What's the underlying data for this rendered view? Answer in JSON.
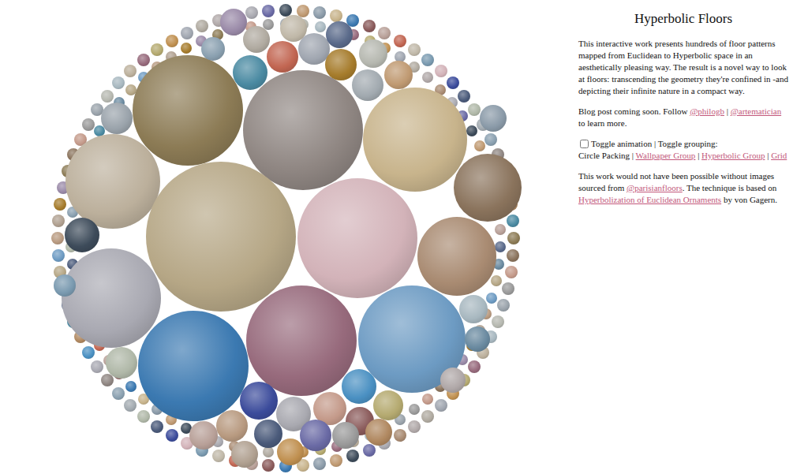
{
  "title": "Hyperbolic Floors",
  "intro": "This interactive work presents hundreds of floor patterns mapped from Euclidean to Hyperbolic space in an aesthetically pleasing way. The result is a novel way to look at floors: transcending the geometry they're confined in -and depicting their infinite nature in a compact way.",
  "follow": {
    "before": "Blog post coming soon. Follow ",
    "links": [
      "@philogb",
      "@artematician"
    ],
    "separator": " | ",
    "after": " to learn more."
  },
  "controls": {
    "animation": {
      "label": "Toggle animation",
      "checked": false
    },
    "grouping_label": " | Toggle grouping:",
    "separator": " | ",
    "grouping": [
      {
        "label": "Circle Packing",
        "selected": true
      },
      {
        "label": "Wallpaper Group",
        "selected": false
      },
      {
        "label": "Hyperbolic Group",
        "selected": false
      },
      {
        "label": "Grid",
        "selected": false
      }
    ]
  },
  "credits": {
    "before": "This work would not have been possible without images sourced from ",
    "source": "@parisianfloors",
    "middle": ". The technique is based on ",
    "paper": "Hyperbolization of Euclidean Ornaments",
    "after": " by von Gagern."
  },
  "circles": [
    {
      "color": "#8c7b55"
    },
    {
      "color": "#8f8682"
    },
    {
      "color": "#c8b48c"
    },
    {
      "color": "#bcb09c"
    },
    {
      "color": "#b6a786"
    },
    {
      "color": "#d3b3b9"
    },
    {
      "color": "#a98b72"
    },
    {
      "color": "#8a735c"
    },
    {
      "color": "#a9a9b2"
    },
    {
      "color": "#3b79b1"
    },
    {
      "color": "#976a7c"
    },
    {
      "color": "#6d9bc3"
    },
    {
      "color": "#3b4b9b"
    },
    {
      "color": "#a9a9b0"
    },
    {
      "color": "#c49a8a"
    },
    {
      "color": "#4a90c2"
    },
    {
      "color": "#8a5a5a"
    },
    {
      "color": "#b5aa70"
    },
    {
      "color": "#b89a80"
    },
    {
      "color": "#4a5a7a"
    },
    {
      "color": "#6a6aa5"
    },
    {
      "color": "#9a9a9a"
    },
    {
      "color": "#b08860"
    },
    {
      "color": "#b8a098"
    },
    {
      "color": "#c09050"
    },
    {
      "color": "#b0a090"
    },
    {
      "color": "#b0b8a8"
    },
    {
      "color": "#3d4b5a"
    },
    {
      "color": "#9aa3ab"
    },
    {
      "color": "#4a8aa2"
    },
    {
      "color": "#c26652"
    },
    {
      "color": "#a0a6b0"
    },
    {
      "color": "#a67c2c"
    },
    {
      "color": "#a2aab0"
    },
    {
      "color": "#c09a72"
    },
    {
      "color": "#b6b8b0"
    },
    {
      "color": "#5a6a8a"
    },
    {
      "color": "#c0b8a8"
    },
    {
      "color": "#b0aaa0"
    },
    {
      "color": "#9a8aa8"
    },
    {
      "color": "#8aa0b0"
    },
    {
      "color": "#8a9aa8"
    },
    {
      "color": "#a8b8c0"
    },
    {
      "color": "#6a8aa0"
    },
    {
      "color": "#7a9ab0"
    },
    {
      "color": "#b0a8a8"
    }
  ]
}
